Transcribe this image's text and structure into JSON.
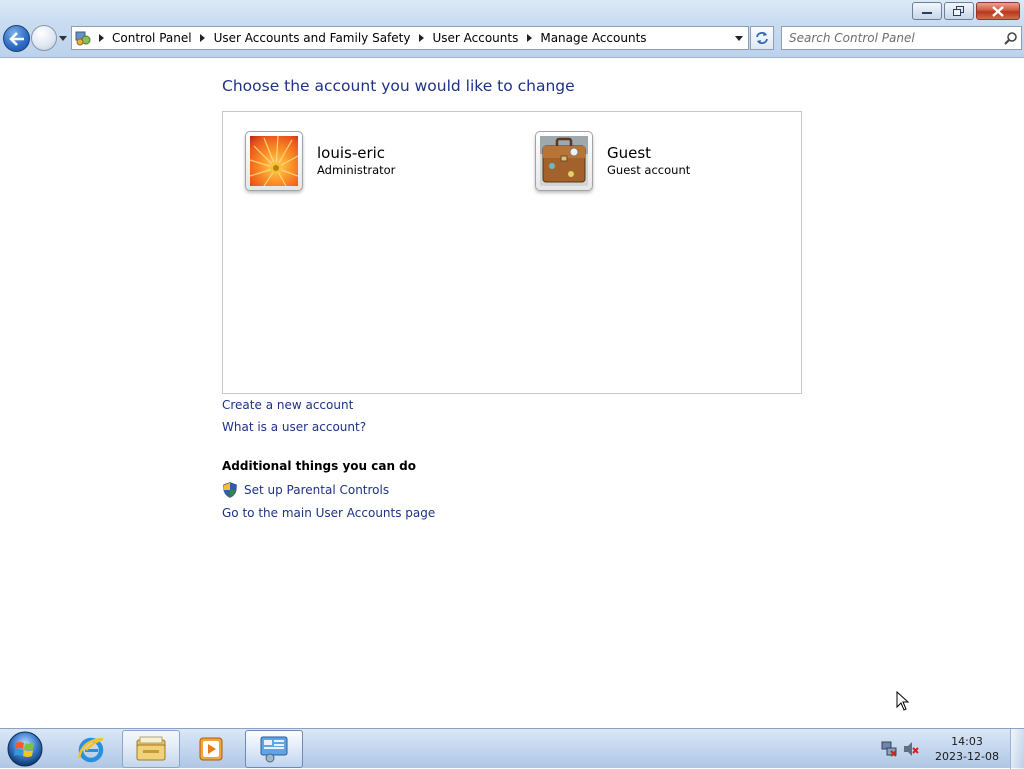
{
  "window": {
    "buttons": [
      "minimize",
      "restore",
      "close"
    ]
  },
  "nav": {
    "breadcrumbs": [
      "Control Panel",
      "User Accounts and Family Safety",
      "User Accounts",
      "Manage Accounts"
    ],
    "search_placeholder": "Search Control Panel"
  },
  "main": {
    "title": "Choose the account you would like to change",
    "accounts": [
      {
        "name": "louis-eric",
        "type": "Administrator",
        "avatar": "orange-flower-picture"
      },
      {
        "name": "Guest",
        "type": "Guest account",
        "avatar": "briefcase-picture"
      }
    ],
    "links": {
      "create_account": "Create a new account",
      "what_is_account": "What is a user account?"
    },
    "additional": {
      "heading": "Additional things you can do",
      "parental_controls": "Set up Parental Controls",
      "main_page": "Go to the main User Accounts page"
    }
  },
  "taskbar": {
    "items": [
      "start-orb",
      "internet-explorer-icon",
      "windows-explorer-icon",
      "media-player-icon",
      "control-panel-icon"
    ],
    "clock": {
      "time": "14:03",
      "date": "2023-12-08"
    }
  },
  "colors": {
    "link": "#1e3287",
    "title": "#1e3287",
    "taskbar": "#c4d7ee"
  }
}
